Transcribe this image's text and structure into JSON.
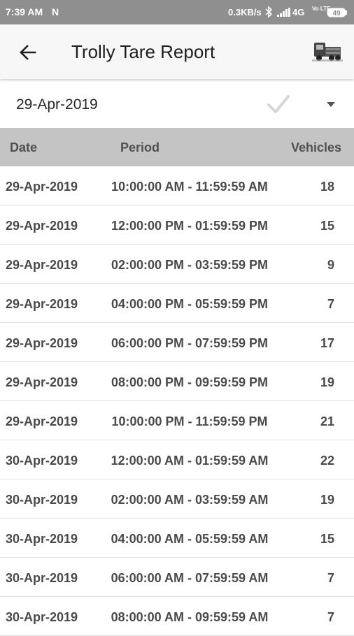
{
  "status_bar": {
    "time": "7:39 AM",
    "notification": "N",
    "speed": "0.3KB/s",
    "network": "4G",
    "volte": "Vo LTE",
    "battery": "49"
  },
  "app_bar": {
    "title": "Trolly Tare Report",
    "back_icon": "arrow-left-icon",
    "action_icon": "truck-icon"
  },
  "selector": {
    "date": "29-Apr-2019"
  },
  "table": {
    "headers": {
      "date": "Date",
      "period": "Period",
      "vehicles": "Vehicles"
    },
    "rows": [
      {
        "date": "29-Apr-2019",
        "period": "10:00:00 AM - 11:59:59 AM",
        "vehicles": "18"
      },
      {
        "date": "29-Apr-2019",
        "period": "12:00:00 PM - 01:59:59 PM",
        "vehicles": "15"
      },
      {
        "date": "29-Apr-2019",
        "period": "02:00:00 PM - 03:59:59 PM",
        "vehicles": "9"
      },
      {
        "date": "29-Apr-2019",
        "period": "04:00:00 PM - 05:59:59 PM",
        "vehicles": "7"
      },
      {
        "date": "29-Apr-2019",
        "period": "06:00:00 PM - 07:59:59 PM",
        "vehicles": "17"
      },
      {
        "date": "29-Apr-2019",
        "period": "08:00:00 PM - 09:59:59 PM",
        "vehicles": "19"
      },
      {
        "date": "29-Apr-2019",
        "period": "10:00:00 PM - 11:59:59 PM",
        "vehicles": "21"
      },
      {
        "date": "30-Apr-2019",
        "period": "12:00:00 AM - 01:59:59 AM",
        "vehicles": "22"
      },
      {
        "date": "30-Apr-2019",
        "period": "02:00:00 AM - 03:59:59 AM",
        "vehicles": "19"
      },
      {
        "date": "30-Apr-2019",
        "period": "04:00:00 AM - 05:59:59 AM",
        "vehicles": "15"
      },
      {
        "date": "30-Apr-2019",
        "period": "06:00:00 AM - 07:59:59 AM",
        "vehicles": "7"
      },
      {
        "date": "30-Apr-2019",
        "period": "08:00:00 AM - 09:59:59 AM",
        "vehicles": "7"
      }
    ]
  }
}
